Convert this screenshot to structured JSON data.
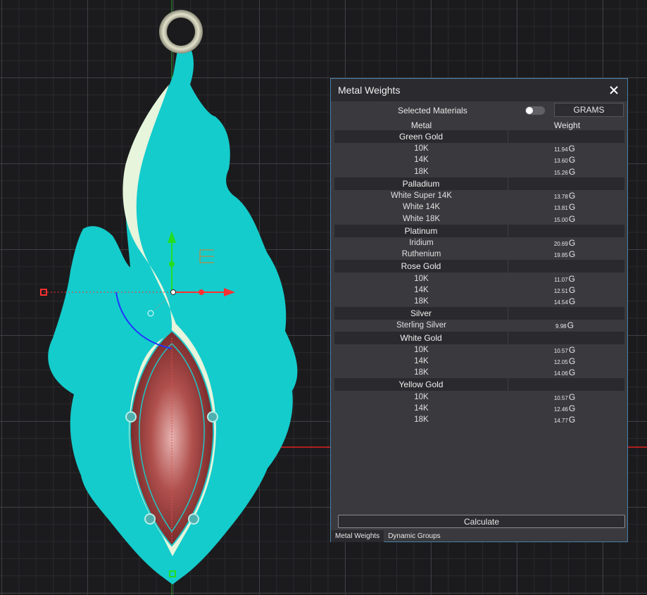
{
  "panel": {
    "title": "Metal Weights",
    "selected_materials_label": "Selected Materials",
    "toggle_on": false,
    "units_label": "GRAMS",
    "columns": {
      "metal": "Metal",
      "weight": "Weight"
    },
    "groups": [
      {
        "name": "Green Gold",
        "items": [
          {
            "name": "10K",
            "value": "11.94",
            "unit": "G"
          },
          {
            "name": "14K",
            "value": "13.60",
            "unit": "G"
          },
          {
            "name": "18K",
            "value": "15.26",
            "unit": "G"
          }
        ]
      },
      {
        "name": "Palladium",
        "items": [
          {
            "name": "White Super 14K",
            "value": "13.78",
            "unit": "G"
          },
          {
            "name": "White 14K",
            "value": "13.81",
            "unit": "G"
          },
          {
            "name": "White 18K",
            "value": "15.00",
            "unit": "G"
          }
        ]
      },
      {
        "name": "Platinum",
        "items": [
          {
            "name": "Iridium",
            "value": "20.69",
            "unit": "G"
          },
          {
            "name": "Ruthenium",
            "value": "19.85",
            "unit": "G"
          }
        ]
      },
      {
        "name": "Rose Gold",
        "items": [
          {
            "name": "10K",
            "value": "11.07",
            "unit": "G"
          },
          {
            "name": "14K",
            "value": "12.51",
            "unit": "G"
          },
          {
            "name": "18K",
            "value": "14.54",
            "unit": "G"
          }
        ]
      },
      {
        "name": "Silver",
        "items": [
          {
            "name": "Sterling Silver",
            "value": "9.98",
            "unit": "G"
          }
        ]
      },
      {
        "name": "White Gold",
        "items": [
          {
            "name": "10K",
            "value": "10.57",
            "unit": "G"
          },
          {
            "name": "14K",
            "value": "12.05",
            "unit": "G"
          },
          {
            "name": "18K",
            "value": "14.06",
            "unit": "G"
          }
        ]
      },
      {
        "name": "Yellow Gold",
        "items": [
          {
            "name": "10K",
            "value": "10.57",
            "unit": "G"
          },
          {
            "name": "14K",
            "value": "12.46",
            "unit": "G"
          },
          {
            "name": "18K",
            "value": "14.77",
            "unit": "G"
          }
        ]
      }
    ],
    "calculate_label": "Calculate",
    "tabs": [
      {
        "label": "Metal Weights",
        "active": true
      },
      {
        "label": "Dynamic Groups",
        "active": false
      }
    ]
  },
  "colors": {
    "flame": "#14cccc",
    "flame_inner": "#e6f5dc",
    "gem": "#a0403f",
    "ring": "#c9c9b0",
    "axis_x": "#ff3030",
    "axis_y": "#22cc22",
    "panel_border": "#4a7ea8"
  },
  "icons": {
    "close": "close-icon"
  }
}
